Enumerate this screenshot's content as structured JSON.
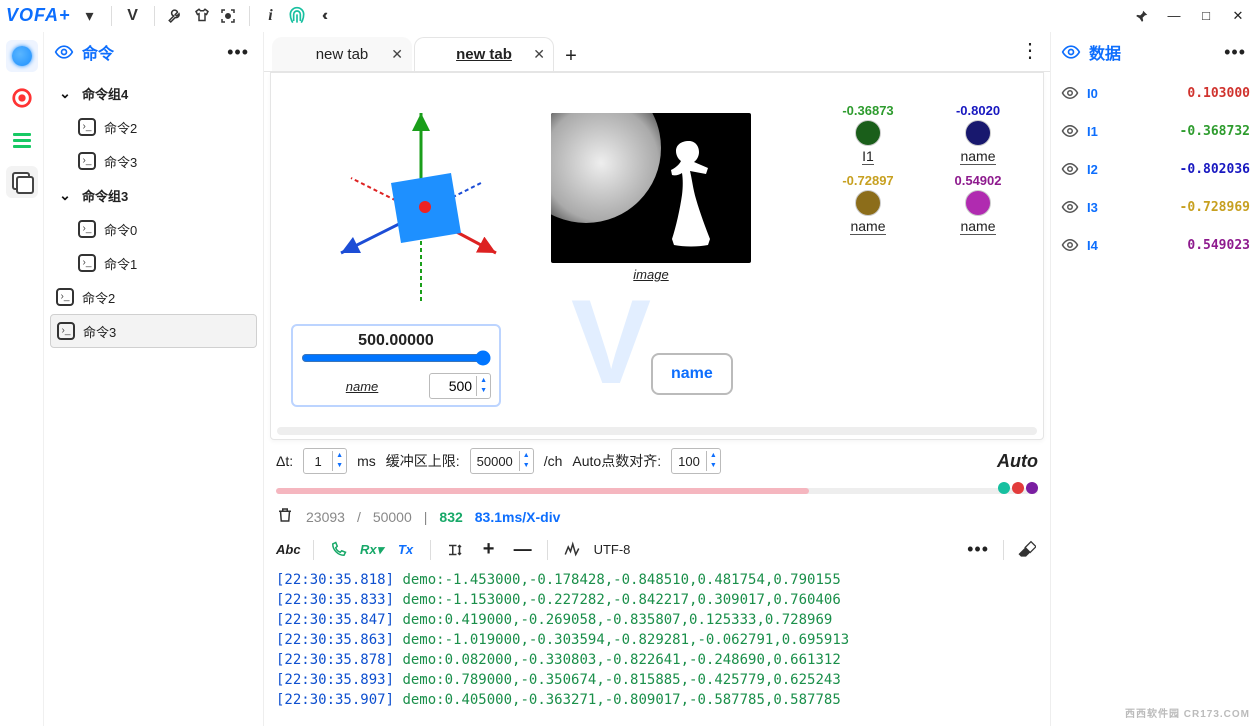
{
  "app": {
    "name": "VOFA+"
  },
  "window_controls": {
    "pin": "📌",
    "min": "—",
    "max": "□",
    "close": "✕"
  },
  "toolbar_icons": [
    "chevron",
    "V",
    "wrench",
    "tshirt",
    "target",
    "info",
    "fingerprint",
    "chevrons-left"
  ],
  "sidebar": {
    "title": "命令",
    "tree": [
      {
        "type": "group",
        "label": "命令组4",
        "children": [
          {
            "label": "命令2"
          },
          {
            "label": "命令3"
          }
        ]
      },
      {
        "type": "group",
        "label": "命令组3",
        "children": [
          {
            "label": "命令0"
          },
          {
            "label": "命令1"
          }
        ]
      },
      {
        "type": "item",
        "label": "命令2"
      },
      {
        "type": "item",
        "label": "命令3",
        "selected": true
      }
    ]
  },
  "tabs": {
    "items": [
      {
        "label": "new tab",
        "active": false
      },
      {
        "label": "new tab",
        "active": true
      }
    ]
  },
  "widgets": {
    "image": {
      "caption": "image"
    },
    "button": {
      "label": "name"
    },
    "slider": {
      "valueText": "500.00000",
      "name": "name",
      "inputValue": "500",
      "min": 0,
      "max": 1000,
      "value": 500
    },
    "dots": [
      {
        "value": "-0.36873",
        "color": "#1a5e1a",
        "name": "I1",
        "valColor": "#2e9c2e"
      },
      {
        "value": "-0.8020",
        "color": "#18186e",
        "name": "name",
        "valColor": "#1818c0"
      },
      {
        "value": "-0.72897",
        "color": "#8c6d1a",
        "name": "name",
        "valColor": "#c7a020"
      },
      {
        "value": "0.54902",
        "color": "#b02bb0",
        "name": "name",
        "valColor": "#8e1b8e"
      }
    ]
  },
  "settings": {
    "dt_label": "Δt:",
    "dt_value": "1",
    "dt_unit": "ms",
    "buf_label": "缓冲区上限:",
    "buf_value": "50000",
    "buf_unit": "/ch",
    "align_label": "Auto点数对齐:",
    "align_value": "100",
    "auto": "Auto"
  },
  "timeline": {
    "markers": [
      "#17c0a0",
      "#e23b3b",
      "#7a1ea1"
    ]
  },
  "status": {
    "count_used": "23093",
    "sep1": "/",
    "count_max": "50000",
    "sep2": "|",
    "rate": "832",
    "tdiv": "83.1ms/X-div"
  },
  "console_toolbar": {
    "abc": "Abc",
    "rx": "Rx",
    "tx": "Tx",
    "plus": "+",
    "minus": "—",
    "encoding": "UTF-8"
  },
  "console": [
    {
      "ts": "[22:30:35.818]",
      "msg": "demo:-1.453000,-0.178428,-0.848510,0.481754,0.790155"
    },
    {
      "ts": "[22:30:35.833]",
      "msg": "demo:-1.153000,-0.227282,-0.842217,0.309017,0.760406"
    },
    {
      "ts": "[22:30:35.847]",
      "msg": "demo:0.419000,-0.269058,-0.835807,0.125333,0.728969"
    },
    {
      "ts": "[22:30:35.863]",
      "msg": "demo:-1.019000,-0.303594,-0.829281,-0.062791,0.695913"
    },
    {
      "ts": "[22:30:35.878]",
      "msg": "demo:0.082000,-0.330803,-0.822641,-0.248690,0.661312"
    },
    {
      "ts": "[22:30:35.893]",
      "msg": "demo:0.789000,-0.350674,-0.815885,-0.425779,0.625243"
    },
    {
      "ts": "[22:30:35.907]",
      "msg": "demo:0.405000,-0.363271,-0.809017,-0.587785,0.587785"
    }
  ],
  "datapanel": {
    "title": "数据",
    "rows": [
      {
        "label": "I0",
        "value": "0.103000",
        "color": "#d0332e"
      },
      {
        "label": "I1",
        "value": "-0.368732",
        "color": "#2e9c2e"
      },
      {
        "label": "I2",
        "value": "-0.802036",
        "color": "#1818c0"
      },
      {
        "label": "I3",
        "value": "-0.728969",
        "color": "#c7a020"
      },
      {
        "label": "I4",
        "value": "0.549023",
        "color": "#8e1b8e"
      }
    ]
  },
  "watermark": "西西软件园  CR173.COM"
}
